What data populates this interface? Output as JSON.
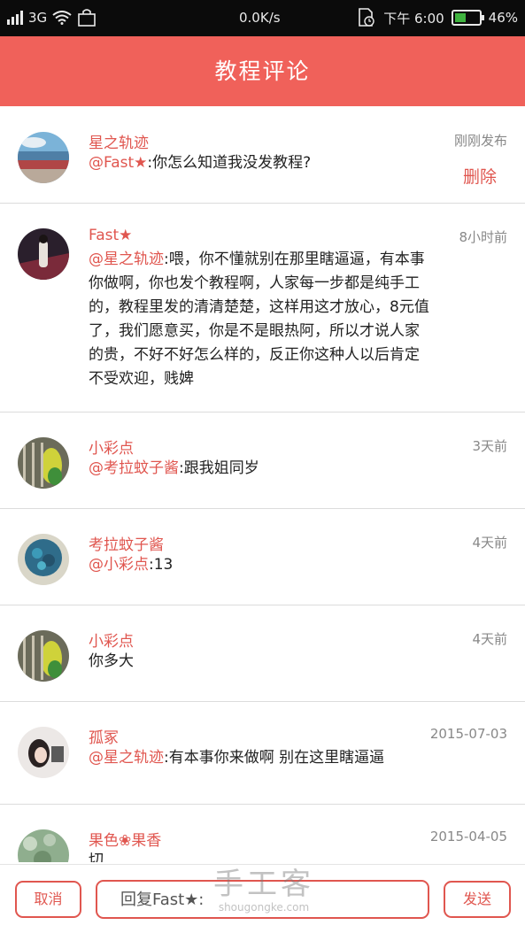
{
  "status_bar": {
    "network": "3G",
    "speed": "0.0K/s",
    "time": "下午 6:00",
    "battery": "46%",
    "battery_level": 0.46
  },
  "header": {
    "title": "教程评论"
  },
  "comments": [
    {
      "author": "星之轨迹",
      "mention": "@Fast★",
      "text": ":你怎么知道我没发教程?",
      "time": "刚刚发布",
      "delete": "删除"
    },
    {
      "author": "Fast★",
      "mention": "@星之轨迹",
      "text": ":喂，你不懂就别在那里瞎逼逼，有本事你做啊，你也发个教程啊，人家每一步都是纯手工的，教程里发的清清楚楚，这样用这才放心，8元值了，我们愿意买，你是不是眼热阿，所以才说人家的贵，不好不好怎么样的，反正你这种人以后肯定不受欢迎，贱婢",
      "time": "8小时前"
    },
    {
      "author": "小彩点",
      "mention": "@考拉蚊子酱",
      "text": ":跟我姐同岁",
      "time": "3天前"
    },
    {
      "author": "考拉蚊子酱",
      "mention": "@小彩点",
      "text": ":13",
      "time": "4天前"
    },
    {
      "author": "小彩点",
      "mention": "",
      "text": "你多大",
      "time": "4天前"
    },
    {
      "author": "孤冢",
      "mention": "@星之轨迹",
      "text": ":有本事你来做啊 别在这里瞎逼逼",
      "time": "2015-07-03"
    },
    {
      "author": "果色❀果香",
      "mention": "",
      "text": "切",
      "time": "2015-04-05"
    }
  ],
  "bottom_bar": {
    "cancel": "取消",
    "reply_placeholder": "回复Fast★:",
    "send": "发送"
  },
  "watermark": {
    "big": "手工客",
    "small": "shougongke.com"
  },
  "colors": {
    "accent": "#f0615a",
    "link": "#e0564f",
    "battery": "#3fb33f"
  }
}
